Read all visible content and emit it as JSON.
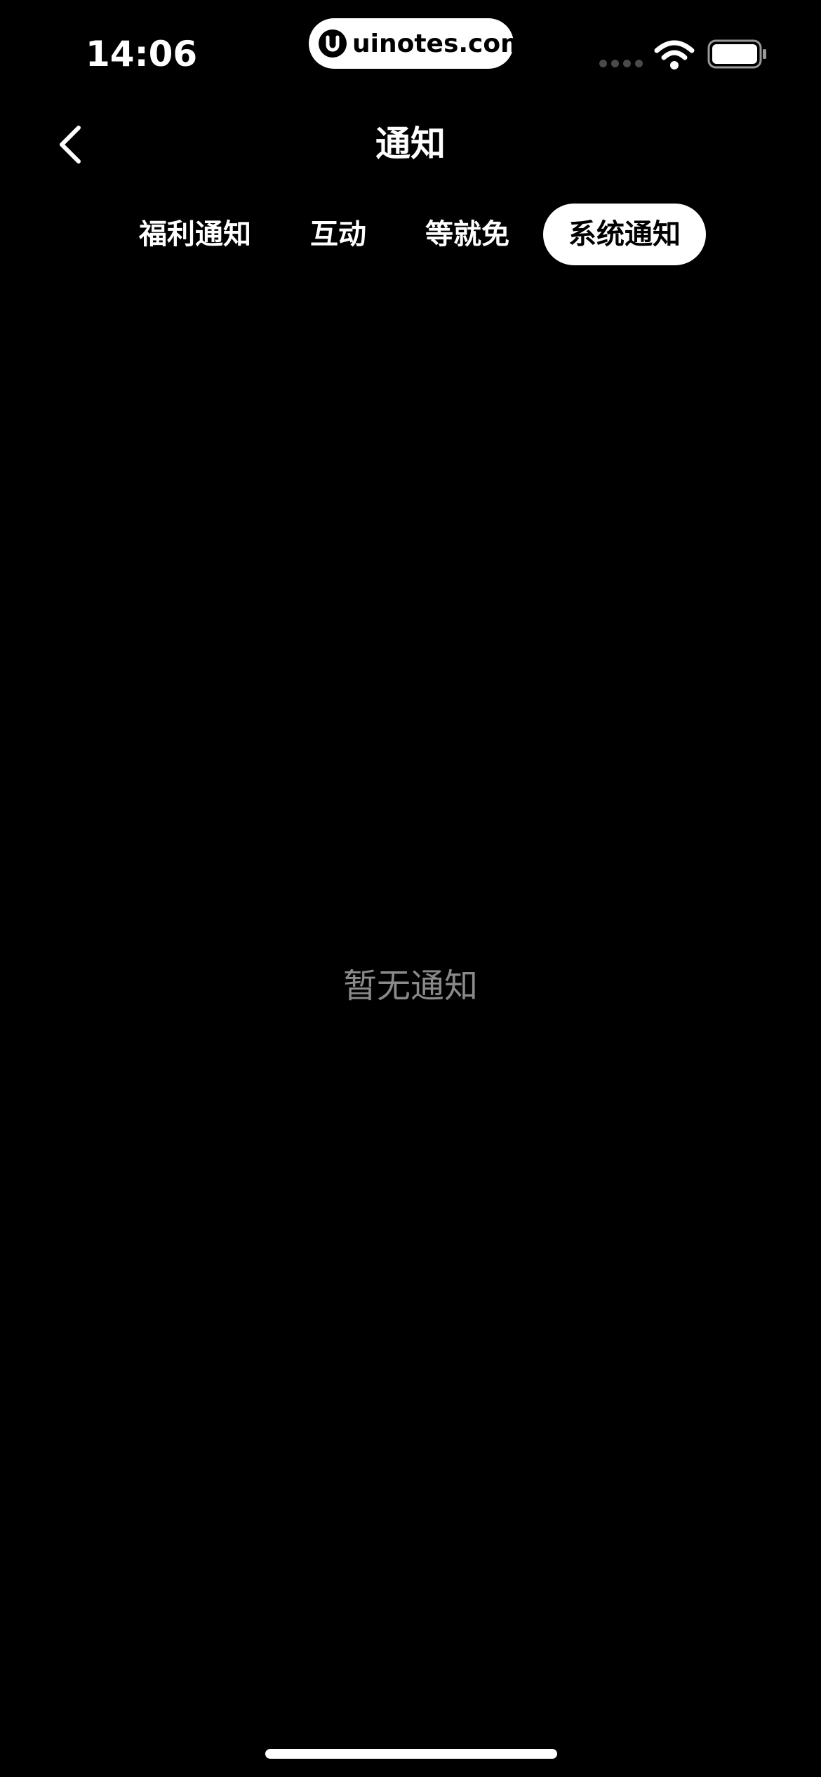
{
  "status_bar": {
    "time": "14:06",
    "watermark": "uinotes.com",
    "icons": [
      "signal-dots-icon",
      "wifi-icon",
      "battery-icon"
    ]
  },
  "nav": {
    "back_icon": "chevron-left-icon",
    "title": "通知"
  },
  "tabs": [
    {
      "label": "福利通知",
      "selected": false
    },
    {
      "label": "互动",
      "selected": false
    },
    {
      "label": "等就免",
      "selected": false
    },
    {
      "label": "系统通知",
      "selected": true
    }
  ],
  "empty_state": {
    "text": "暂无通知"
  },
  "colors": {
    "background": "#000000",
    "text_primary": "#ffffff",
    "text_muted": "#8a8a8a",
    "selected_tab_bg": "#ffffff",
    "selected_tab_text": "#000000"
  }
}
